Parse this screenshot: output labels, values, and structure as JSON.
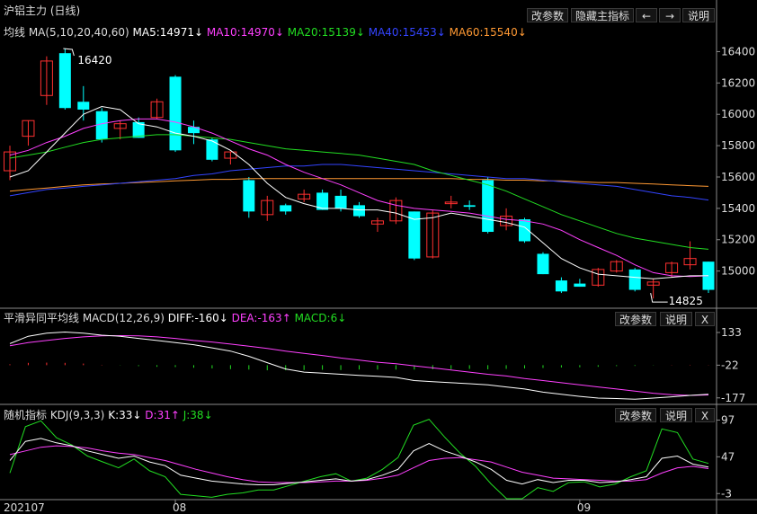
{
  "panel_title": "沪铝主力 (日线)",
  "main_toolbar": {
    "change_params": "改参数",
    "hide_indicator": "隐藏主指标",
    "prev": "←",
    "next": "→",
    "help": "说明"
  },
  "ma_legend": {
    "label": "均线 MA(5,10,20,40,60)",
    "ma5": "MA5:14971↓",
    "ma10": "MA10:14970↓",
    "ma20": "MA20:15139↓",
    "ma40": "MA40:15453↓",
    "ma60": "MA60:15540↓"
  },
  "price_annotations": {
    "high": "16420",
    "low": "14825"
  },
  "macd_legend": {
    "label": "平滑异同平均线 MACD(12,26,9)",
    "diff": "DIFF:-160↓",
    "dea": "DEA:-163↑",
    "macd": "MACD:6↓"
  },
  "macd_toolbar": {
    "change_params": "改参数",
    "help": "说明",
    "close": "X"
  },
  "kdj_legend": {
    "label": "随机指标 KDJ(9,3,3)",
    "k": "K:33↓",
    "d": "D:31↑",
    "j": "J:38↓"
  },
  "kdj_toolbar": {
    "change_params": "改参数",
    "help": "说明",
    "close": "X"
  },
  "colors": {
    "up": "#ff3030",
    "down": "#00ffff",
    "ma5": "#ffffff",
    "ma10": "#ff40ff",
    "ma20": "#22dd22",
    "ma40": "#3344ff",
    "ma60": "#ff9933",
    "axis": "#8a8a8a"
  },
  "chart_data": [
    {
      "type": "candlestick",
      "title": "沪铝主力 (日线)",
      "y_ticks": [
        "16400",
        "16200",
        "16000",
        "15800",
        "15600",
        "15400",
        "15200",
        "15000"
      ],
      "ylim": [
        14780,
        16500
      ],
      "x_tick_labels": [
        "202107",
        "08",
        "09"
      ],
      "x_tick_index": [
        0,
        9,
        31
      ],
      "candles": [
        {
          "o": 15640,
          "h": 15800,
          "l": 15580,
          "c": 15760
        },
        {
          "o": 15860,
          "h": 15960,
          "l": 15800,
          "c": 15960
        },
        {
          "o": 16120,
          "h": 16370,
          "l": 16060,
          "c": 16340
        },
        {
          "o": 16390,
          "h": 16420,
          "l": 16030,
          "c": 16040
        },
        {
          "o": 16080,
          "h": 16180,
          "l": 15960,
          "c": 16030
        },
        {
          "o": 16020,
          "h": 16040,
          "l": 15820,
          "c": 15840
        },
        {
          "o": 15910,
          "h": 15960,
          "l": 15840,
          "c": 15940
        },
        {
          "o": 15950,
          "h": 15980,
          "l": 15850,
          "c": 15850
        },
        {
          "o": 15980,
          "h": 16100,
          "l": 15970,
          "c": 16080
        },
        {
          "o": 16240,
          "h": 16250,
          "l": 15760,
          "c": 15770
        },
        {
          "o": 15920,
          "h": 15960,
          "l": 15810,
          "c": 15880
        },
        {
          "o": 15840,
          "h": 15850,
          "l": 15700,
          "c": 15710
        },
        {
          "o": 15720,
          "h": 15760,
          "l": 15680,
          "c": 15760
        },
        {
          "o": 15580,
          "h": 15600,
          "l": 15340,
          "c": 15380
        },
        {
          "o": 15360,
          "h": 15480,
          "l": 15320,
          "c": 15450
        },
        {
          "o": 15420,
          "h": 15430,
          "l": 15360,
          "c": 15380
        },
        {
          "o": 15460,
          "h": 15520,
          "l": 15440,
          "c": 15490
        },
        {
          "o": 15500,
          "h": 15520,
          "l": 15390,
          "c": 15390
        },
        {
          "o": 15480,
          "h": 15520,
          "l": 15380,
          "c": 15400
        },
        {
          "o": 15420,
          "h": 15440,
          "l": 15340,
          "c": 15350
        },
        {
          "o": 15300,
          "h": 15340,
          "l": 15250,
          "c": 15320
        },
        {
          "o": 15320,
          "h": 15470,
          "l": 15300,
          "c": 15450
        },
        {
          "o": 15380,
          "h": 15380,
          "l": 15070,
          "c": 15080
        },
        {
          "o": 15090,
          "h": 15390,
          "l": 15080,
          "c": 15370
        },
        {
          "o": 15430,
          "h": 15480,
          "l": 15400,
          "c": 15440
        },
        {
          "o": 15420,
          "h": 15450,
          "l": 15390,
          "c": 15410
        },
        {
          "o": 15580,
          "h": 15600,
          "l": 15240,
          "c": 15250
        },
        {
          "o": 15290,
          "h": 15400,
          "l": 15260,
          "c": 15350
        },
        {
          "o": 15330,
          "h": 15340,
          "l": 15180,
          "c": 15190
        },
        {
          "o": 15110,
          "h": 15120,
          "l": 14980,
          "c": 14980
        },
        {
          "o": 14940,
          "h": 14960,
          "l": 14860,
          "c": 14870
        },
        {
          "o": 14920,
          "h": 14950,
          "l": 14900,
          "c": 14900
        },
        {
          "o": 14910,
          "h": 15020,
          "l": 14900,
          "c": 15010
        },
        {
          "o": 15000,
          "h": 15070,
          "l": 14990,
          "c": 15060
        },
        {
          "o": 15010,
          "h": 15020,
          "l": 14870,
          "c": 14880
        },
        {
          "o": 14910,
          "h": 14950,
          "l": 14825,
          "c": 14930
        },
        {
          "o": 14990,
          "h": 15060,
          "l": 14960,
          "c": 15050
        },
        {
          "o": 15040,
          "h": 15190,
          "l": 15010,
          "c": 15080
        },
        {
          "o": 15060,
          "h": 15060,
          "l": 14860,
          "c": 14880
        }
      ],
      "ma5": [
        15600,
        15640,
        15760,
        15880,
        16000,
        16050,
        16030,
        15940,
        15920,
        15880,
        15860,
        15830,
        15770,
        15680,
        15560,
        15470,
        15430,
        15400,
        15400,
        15390,
        15390,
        15370,
        15330,
        15340,
        15370,
        15350,
        15330,
        15310,
        15280,
        15180,
        15080,
        15020,
        14980,
        14970,
        14960,
        14950,
        14960,
        14970,
        14971
      ],
      "ma10": [
        15740,
        15770,
        15820,
        15860,
        15910,
        15940,
        15960,
        15970,
        15970,
        15950,
        15920,
        15880,
        15830,
        15780,
        15740,
        15680,
        15630,
        15590,
        15550,
        15500,
        15450,
        15420,
        15400,
        15390,
        15380,
        15370,
        15350,
        15330,
        15320,
        15300,
        15260,
        15200,
        15150,
        15100,
        15040,
        14990,
        14970,
        14965,
        14970
      ],
      "ma20": [
        15720,
        15740,
        15760,
        15790,
        15820,
        15840,
        15850,
        15860,
        15870,
        15870,
        15860,
        15850,
        15840,
        15820,
        15800,
        15780,
        15770,
        15760,
        15750,
        15740,
        15720,
        15700,
        15680,
        15640,
        15610,
        15580,
        15550,
        15510,
        15460,
        15410,
        15360,
        15320,
        15280,
        15240,
        15210,
        15190,
        15170,
        15150,
        15139
      ],
      "ma40": [
        15480,
        15500,
        15520,
        15530,
        15540,
        15550,
        15560,
        15570,
        15580,
        15590,
        15610,
        15620,
        15640,
        15650,
        15660,
        15670,
        15670,
        15680,
        15680,
        15670,
        15660,
        15650,
        15640,
        15630,
        15620,
        15610,
        15600,
        15590,
        15590,
        15580,
        15570,
        15560,
        15550,
        15540,
        15520,
        15500,
        15480,
        15470,
        15453
      ],
      "ma60": [
        15510,
        15520,
        15530,
        15540,
        15550,
        15555,
        15560,
        15565,
        15570,
        15575,
        15580,
        15585,
        15585,
        15590,
        15590,
        15590,
        15590,
        15590,
        15590,
        15590,
        15590,
        15590,
        15590,
        15590,
        15590,
        15585,
        15585,
        15580,
        15580,
        15575,
        15575,
        15570,
        15565,
        15565,
        15560,
        15555,
        15550,
        15545,
        15540
      ]
    },
    {
      "type": "line",
      "title": "平滑异同平均线 MACD(12,26,9)",
      "y_ticks": [
        "133",
        "-22",
        "-177"
      ],
      "ylim": [
        -195,
        150
      ],
      "diff": [
        80,
        115,
        130,
        135,
        130,
        120,
        115,
        105,
        95,
        85,
        75,
        60,
        45,
        20,
        -10,
        -40,
        -55,
        -60,
        -65,
        -70,
        -75,
        -80,
        -95,
        -100,
        -105,
        -110,
        -115,
        -125,
        -135,
        -150,
        -160,
        -170,
        -178,
        -180,
        -183,
        -178,
        -172,
        -165,
        -160
      ],
      "dea": [
        70,
        85,
        95,
        105,
        112,
        117,
        118,
        117,
        112,
        105,
        95,
        88,
        78,
        68,
        57,
        45,
        34,
        24,
        12,
        2,
        -8,
        -15,
        -25,
        -35,
        -45,
        -55,
        -65,
        -73,
        -85,
        -95,
        -105,
        -115,
        -125,
        -135,
        -145,
        -155,
        -162,
        -165,
        -163
      ],
      "macd": [
        20,
        50,
        55,
        50,
        35,
        8,
        -5,
        -20,
        -35,
        -40,
        -55,
        -70,
        -85,
        -95,
        -110,
        -110,
        -105,
        -100,
        -105,
        -95,
        -95,
        -95,
        -95,
        -90,
        -85,
        -80,
        -90,
        -80,
        -70,
        -60,
        -50,
        -45,
        -35,
        -20,
        -15,
        -5,
        5,
        8,
        6
      ]
    },
    {
      "type": "line",
      "title": "随机指标 KDJ(9,3,3)",
      "y_ticks": [
        "97",
        "47",
        "-3"
      ],
      "ylim": [
        -10,
        100
      ],
      "k": [
        42,
        68,
        72,
        66,
        62,
        55,
        50,
        45,
        48,
        40,
        35,
        22,
        18,
        14,
        12,
        10,
        9,
        9,
        11,
        13,
        15,
        17,
        14,
        16,
        22,
        30,
        55,
        65,
        55,
        48,
        40,
        30,
        15,
        10,
        16,
        12,
        15,
        15,
        12,
        13,
        16,
        20,
        45,
        48,
        37,
        33
      ],
      "d": [
        50,
        55,
        60,
        62,
        61,
        59,
        55,
        52,
        50,
        46,
        42,
        36,
        30,
        25,
        20,
        16,
        13,
        12,
        12,
        12,
        13,
        14,
        14,
        15,
        18,
        22,
        32,
        42,
        45,
        46,
        43,
        40,
        33,
        26,
        22,
        18,
        17,
        16,
        15,
        14,
        14,
        16,
        25,
        32,
        34,
        31
      ],
      "j": [
        25,
        88,
        96,
        73,
        63,
        48,
        40,
        32,
        44,
        28,
        20,
        -4,
        -6,
        -8,
        -4,
        -2,
        2,
        2,
        8,
        14,
        20,
        24,
        14,
        18,
        30,
        46,
        90,
        98,
        74,
        52,
        34,
        10,
        -20,
        -20,
        5,
        0,
        12,
        13,
        6,
        10,
        20,
        28,
        85,
        80,
        44,
        38
      ]
    }
  ]
}
